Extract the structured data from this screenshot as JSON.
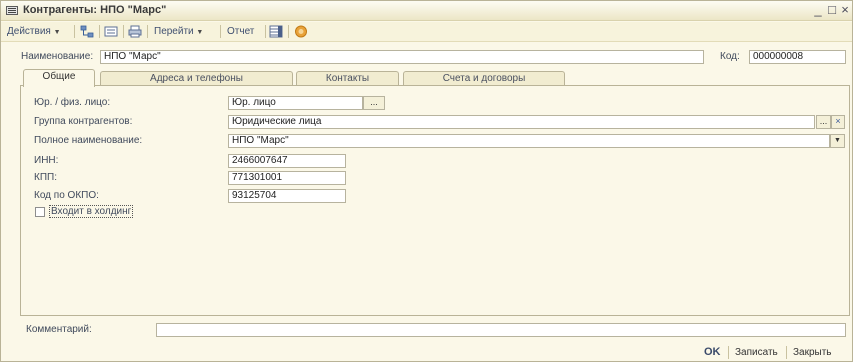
{
  "window": {
    "title": "Контрагенты: НПО \"Марс\"",
    "minimize": "_",
    "maximize": "□",
    "close": "×"
  },
  "toolbar": {
    "actions": "Действия",
    "goto": "Перейти",
    "report": "Отчет"
  },
  "header": {
    "name_label": "Наименование:",
    "name_value": "НПО \"Марс\"",
    "code_label": "Код:",
    "code_value": "000000008"
  },
  "tabs": [
    {
      "label": "Общие",
      "active": true
    },
    {
      "label": "Адреса и телефоны",
      "active": false
    },
    {
      "label": "Контакты",
      "active": false
    },
    {
      "label": "Счета и договоры",
      "active": false
    }
  ],
  "general": {
    "entity_type_label": "Юр. / физ. лицо:",
    "entity_type_value": "Юр. лицо",
    "group_label": "Группа контрагентов:",
    "group_value": "Юридические лица",
    "full_name_label": "Полное наименование:",
    "full_name_value": "НПО \"Марс\"",
    "inn_label": "ИНН:",
    "inn_value": "2466007647",
    "kpp_label": "КПП:",
    "kpp_value": "771301001",
    "okpo_label": "Код по ОКПО:",
    "okpo_value": "93125704",
    "holding_label": "Входит в холдинг"
  },
  "comment": {
    "label": "Комментарий:",
    "value": ""
  },
  "buttons": {
    "ok": "OK",
    "save": "Записать",
    "close": "Закрыть"
  },
  "colors": {
    "window_bg": "#fbf8e8",
    "accent_orange": "#e8a23a",
    "toolbar_text": "#3f4f70"
  }
}
